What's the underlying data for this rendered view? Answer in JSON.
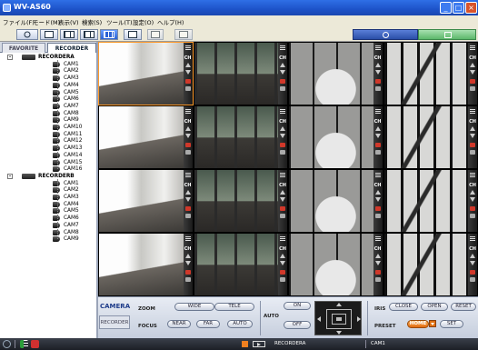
{
  "window": {
    "title": "WV-AS60"
  },
  "menu": [
    {
      "label": "ファイル(F)"
    },
    {
      "label": "モード(M)"
    },
    {
      "label": "表示(V)"
    },
    {
      "label": "検索(S)"
    },
    {
      "label": "ツール(T)"
    },
    {
      "label": "設定(O)"
    },
    {
      "label": "ヘルプ(H)"
    }
  ],
  "sidebar": {
    "tabs": {
      "favorite": "FAVORITE",
      "recorder": "RECORDER"
    },
    "recorders": [
      {
        "name": "RECORDERA",
        "expander": "-",
        "cameras": [
          "CAM1",
          "CAM2",
          "CAM3",
          "CAM4",
          "CAM5",
          "CAM6",
          "CAM7",
          "CAM8",
          "CAM9",
          "CAM10",
          "CAM11",
          "CAM12",
          "CAM13",
          "CAM14",
          "CAM15",
          "CAM16"
        ]
      },
      {
        "name": "RECORDERB",
        "expander": "-",
        "cameras": [
          "CAM1",
          "CAM2",
          "CAM3",
          "CAM4",
          "CAM5",
          "CAM6",
          "CAM7",
          "CAM8",
          "CAM9"
        ]
      }
    ]
  },
  "grid": {
    "channel_label": "CH",
    "rows": 4,
    "cols": 4,
    "selected_cell": 0,
    "scene_pattern": [
      "a",
      "b",
      "c",
      "d"
    ]
  },
  "control": {
    "camera_label": "CAMERA",
    "recorder_tab": "RECORDER",
    "zoom_label": "ZOOM",
    "wide": "WIDE",
    "tele": "TELE",
    "focus_label": "FOCUS",
    "near": "NEAR",
    "far": "FAR",
    "focus_auto": "AUTO",
    "auto_label": "AUTO",
    "on": "ON",
    "off": "OFF",
    "iris_label": "IRIS",
    "close": "CLOSE",
    "open": "OPEN",
    "reset": "RESET",
    "preset_label": "PRESET",
    "home": "HOME",
    "set": "SET"
  },
  "status": {
    "recorder": "RECORDERA",
    "camera": "CAM1"
  },
  "colors": {
    "accent": "#2a62d4",
    "selected_cell": "#ff9a2a",
    "preset_home": "#e06a10"
  }
}
